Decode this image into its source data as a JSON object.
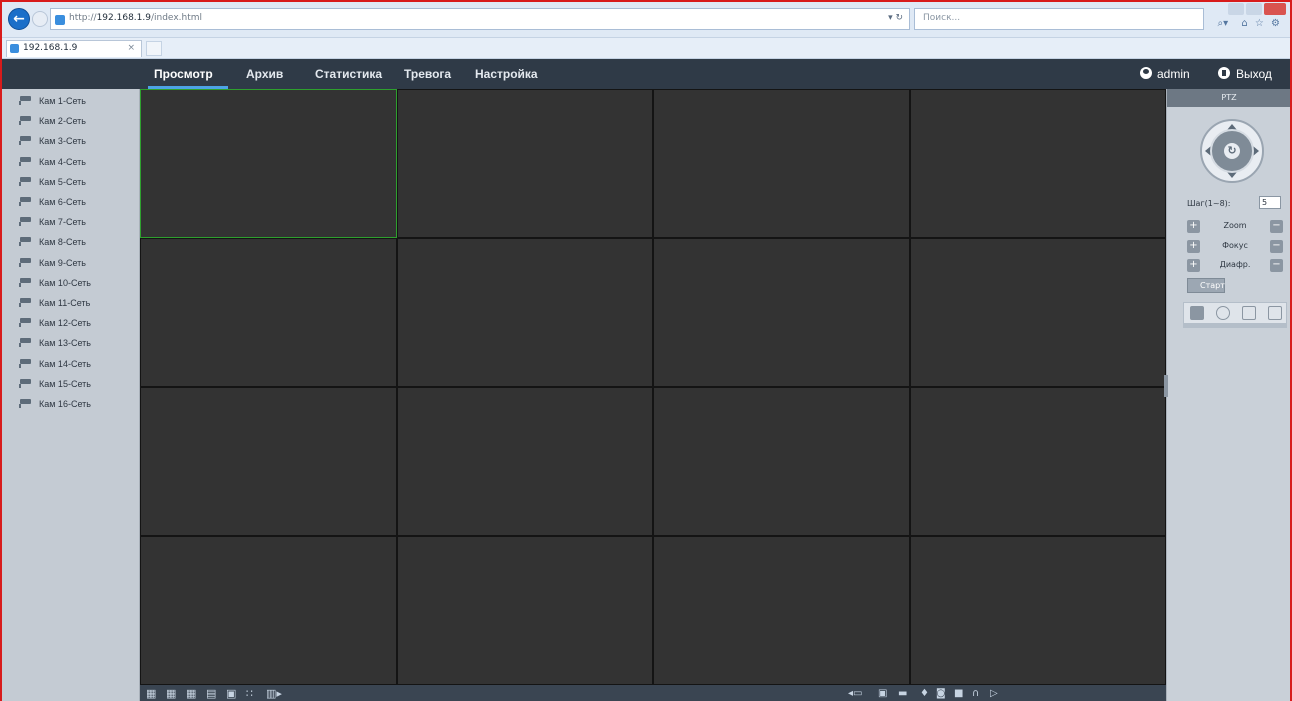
{
  "browser": {
    "url_prefix": "http://",
    "url_host": "192.168.1.9",
    "url_path": "/index.html",
    "search_placeholder": "Поиск...",
    "tab_title": "192.168.1.9",
    "tab_close": "×",
    "refresh": "▾ ↻"
  },
  "nav": {
    "items": [
      {
        "label": "Просмотр",
        "active": true
      },
      {
        "label": "Архив",
        "active": false
      },
      {
        "label": "Статистика",
        "active": false
      },
      {
        "label": "Тревога",
        "active": false
      },
      {
        "label": "Настройка",
        "active": false
      }
    ],
    "user": "admin",
    "logout": "Выход"
  },
  "cameras": [
    "Кам 1-Сеть",
    "Кам 2-Сеть",
    "Кам 3-Сеть",
    "Кам 4-Сеть",
    "Кам 5-Сеть",
    "Кам 6-Сеть",
    "Кам 7-Сеть",
    "Кам 8-Сеть",
    "Кам 9-Сеть",
    "Кам 10-Сеть",
    "Кам 11-Сеть",
    "Кам 12-Сеть",
    "Кам 13-Сеть",
    "Кам 14-Сеть",
    "Кам 15-Сеть",
    "Кам 16-Сеть"
  ],
  "grid": {
    "rows": 4,
    "cols": 4,
    "selected_index": 0
  },
  "ptz": {
    "title": "PTZ",
    "step_label": "Шаг(1~8):",
    "step_value": "5",
    "zoom_label": "Zoom",
    "focus_label": "Фокус",
    "iris_label": "Диафр.",
    "start_label": "Старт",
    "plus": "+",
    "minus": "−"
  },
  "colors": {
    "header_bg": "#2f3a47",
    "selected_border": "#2ea02e",
    "cell_bg": "#333333",
    "accent": "#4da3e6"
  }
}
